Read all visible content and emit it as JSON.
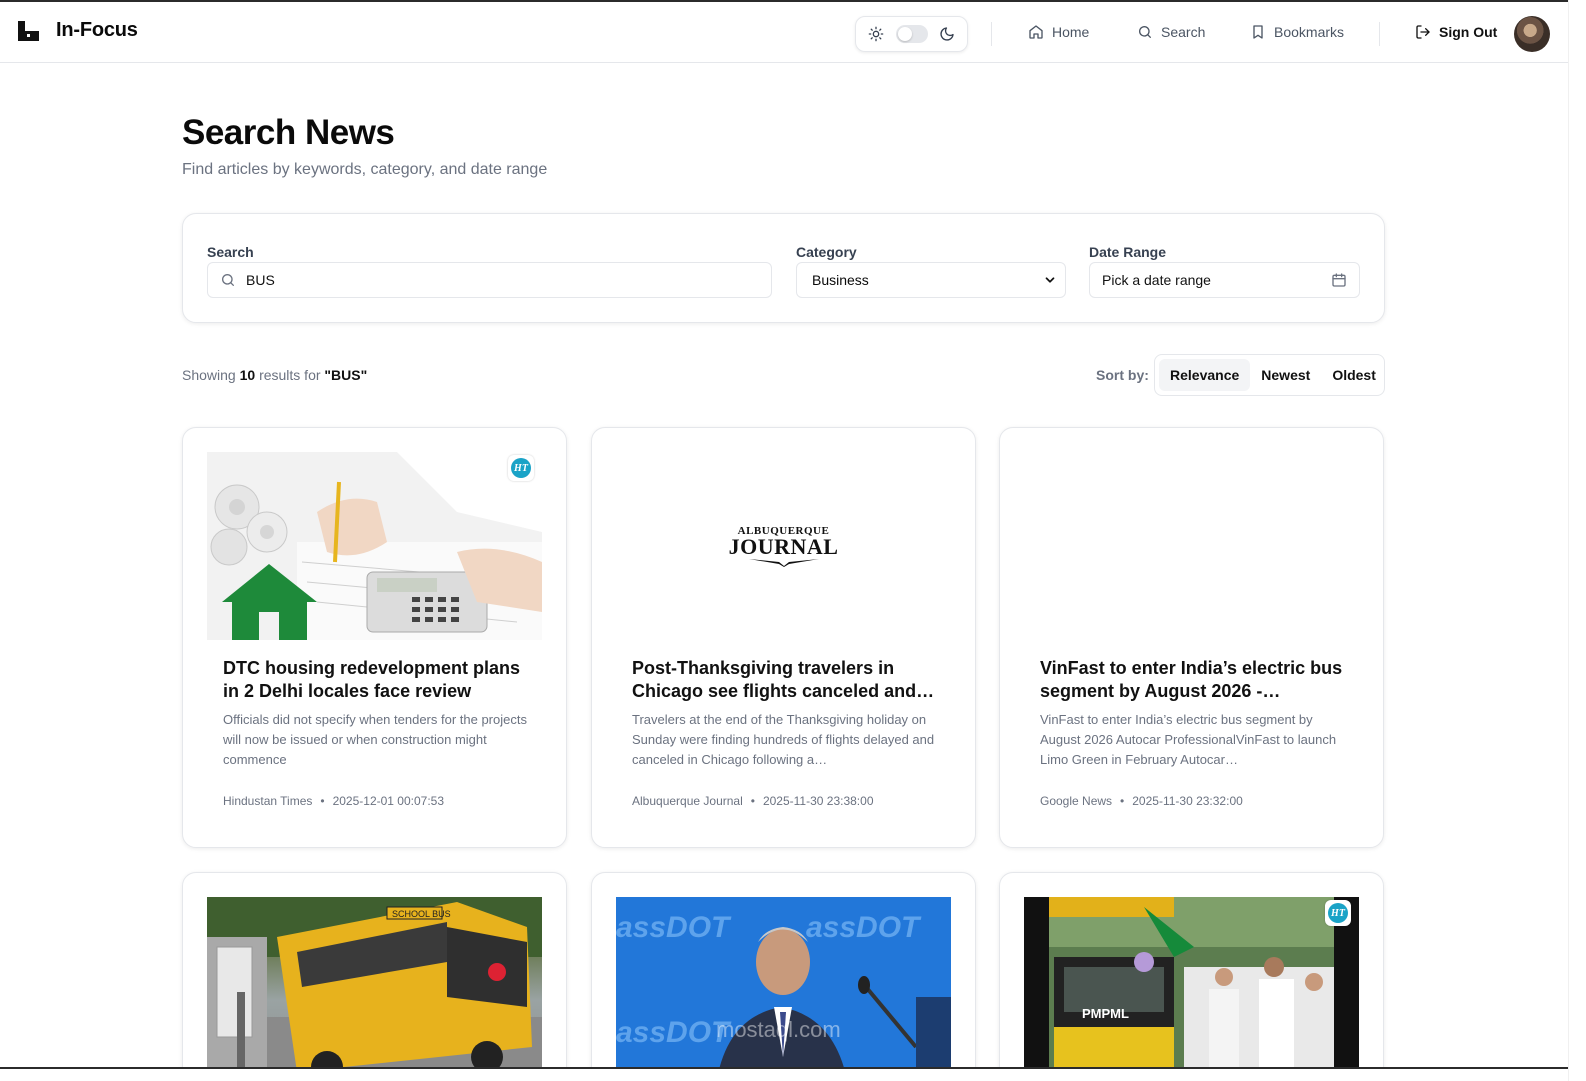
{
  "header": {
    "brand": "In-Focus",
    "nav": [
      {
        "label": "Home",
        "icon": "home-icon"
      },
      {
        "label": "Search",
        "icon": "search-icon"
      },
      {
        "label": "Bookmarks",
        "icon": "bookmark-icon"
      }
    ],
    "sign_out": "Sign Out"
  },
  "page": {
    "title": "Search News",
    "subtitle": "Find articles by keywords, category, and date range"
  },
  "filters": {
    "search_label": "Search",
    "search_value": "BUS",
    "category_label": "Category",
    "category_value": "Business",
    "date_label": "Date Range",
    "date_placeholder": "Pick a date range"
  },
  "results": {
    "prefix": "Showing",
    "count": "10",
    "middle": "results for",
    "query": "\"BUS\""
  },
  "sort": {
    "label": "Sort by:",
    "options": [
      "Relevance",
      "Newest",
      "Oldest"
    ],
    "active": "Relevance"
  },
  "articles": [
    {
      "title": "DTC housing redevelopment plans in 2 Delhi locales face review",
      "description": "Officials did not specify when tenders for the projects will now be issued or when construction might commence",
      "source": "Hindustan Times",
      "date": "2025-12-01 00:07:53"
    },
    {
      "title": "Post-Thanksgiving travelers in Chicago see flights canceled and delayed after…",
      "description": "Travelers at the end of the Thanksgiving holiday on Sunday were finding hundreds of flights delayed and canceled in Chicago following a…",
      "source": "Albuquerque Journal",
      "date": "2025-11-30 23:38:00",
      "logo_top": "ALBUQUERQUE",
      "logo_main": "JOURNAL"
    },
    {
      "title": "VinFast to enter India’s electric bus segment by August 2026 - Autocar…",
      "description": "VinFast to enter India’s electric bus segment by August 2026 Autocar ProfessionalVinFast to launch Limo Green in February Autocar…",
      "source": "Google News",
      "date": "2025-11-30 23:32:00"
    }
  ],
  "thumb_text": {
    "school_bus": "SCHOOL BUS",
    "massdot": "assDOT",
    "watermark": "mostaql.com",
    "pmpml": "PMPML",
    "ht_badge": "HT"
  },
  "colors": {
    "accent": "#111111",
    "muted_text": "#6b7280",
    "border": "#e5e7eb",
    "ht_blue": "#1aa3c7"
  }
}
